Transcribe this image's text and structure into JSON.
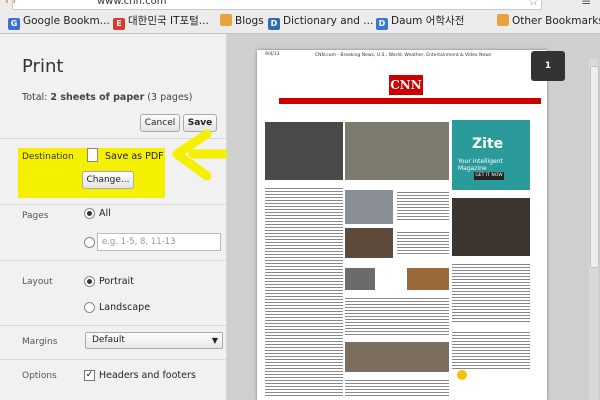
{
  "browser": {
    "url": "www.cnn.com",
    "bookmarks": [
      {
        "label": "Google Bookm...",
        "icon": "google-icon",
        "color": "#3b6fd8"
      },
      {
        "label": "대한민국 IT포털...",
        "icon": "e-portal-icon",
        "color": "#d63b2f"
      },
      {
        "label": "Blogs",
        "icon": "folder-icon",
        "color": "#e8a33c"
      },
      {
        "label": "Dictionary and ...",
        "icon": "dictionary-icon",
        "color": "#2e6fb0"
      },
      {
        "label": "Daum 어학사전",
        "icon": "daum-icon",
        "color": "#3a76d0"
      },
      {
        "label": "Other Bookmarks",
        "icon": "folder-icon",
        "color": "#e8a33c"
      }
    ]
  },
  "print": {
    "title": "Print",
    "total_prefix": "Total:",
    "total_bold": "2 sheets of paper",
    "total_suffix": "(3 pages)",
    "cancel_label": "Cancel",
    "save_label": "Save",
    "destination_label": "Destination",
    "destination_value": "Save as PDF",
    "change_label": "Change...",
    "pages_label": "Pages",
    "pages_all": "All",
    "pages_placeholder": "e.g. 1-5, 8, 11-13",
    "layout_label": "Layout",
    "layout_portrait": "Portrait",
    "layout_landscape": "Landscape",
    "margins_label": "Margins",
    "margins_value": "Default",
    "options_label": "Options",
    "options_headers": "Headers and footers",
    "highlight_color": "#f4f000"
  },
  "preview": {
    "page_number": "1",
    "header_left": "9/4/13",
    "header_center": "CNN.com - Breaking News, U.S., World, Weather, Entertainment & Video News",
    "logo": "CNN",
    "ad_brand": "Zite",
    "ad_tagline": "Your intelligent Magazine",
    "ad_button": "GET IT NOW"
  }
}
